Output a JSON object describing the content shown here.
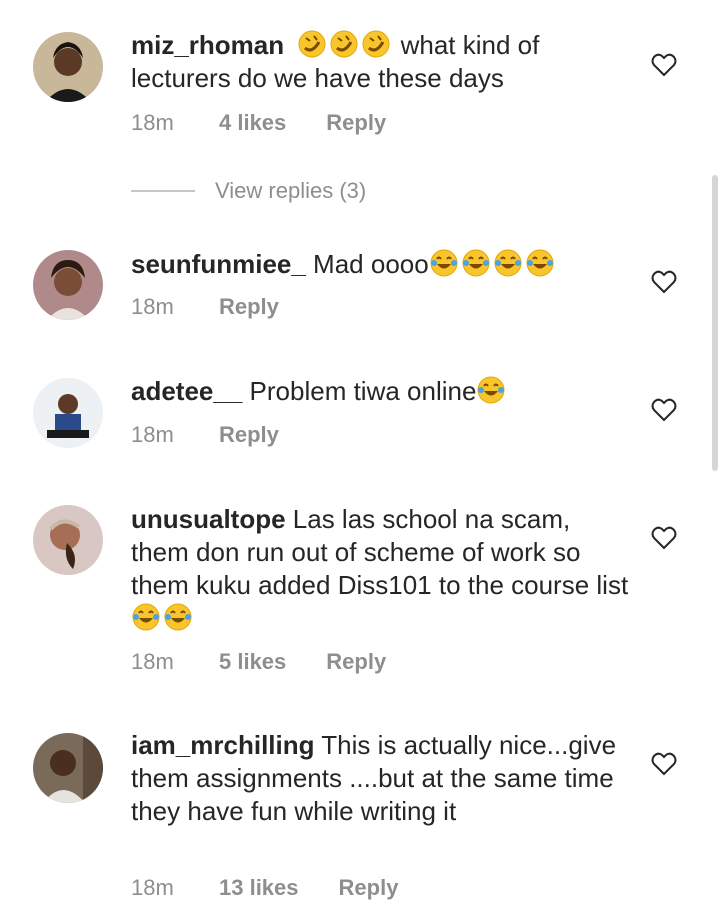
{
  "comments": [
    {
      "username": "miz_rhoman",
      "text": " what kind of lecturers do we have these days",
      "emoji_before": [
        "rofl-emoji",
        "rofl-emoji",
        "rofl-emoji"
      ],
      "time": "18m",
      "likes": "4 likes",
      "reply": "Reply",
      "view_replies": "View replies (3)"
    },
    {
      "username": "seunfunmiee_",
      "text": " Mad oooo",
      "emoji_after": [
        "tears-of-joy-emoji",
        "tears-of-joy-emoji",
        "tears-of-joy-emoji",
        "tears-of-joy-emoji"
      ],
      "time": "18m",
      "reply": "Reply"
    },
    {
      "username": "adetee__",
      "text": " Problem tiwa online",
      "emoji_after": [
        "tears-of-joy-emoji"
      ],
      "time": "18m",
      "reply": "Reply"
    },
    {
      "username": "unusualtope",
      "text": " Las las school na scam, them don run out of scheme of work so them kuku added Diss101 to the course list",
      "emoji_after": [
        "tears-of-joy-emoji",
        "tears-of-joy-emoji"
      ],
      "time": "18m",
      "likes": "5 likes",
      "reply": "Reply"
    },
    {
      "username": "iam_mrchilling",
      "text": " This is actually nice...give them assignments ....but at the same time they have fun while writing it",
      "time": "18m",
      "likes": "13 likes",
      "reply": "Reply"
    }
  ],
  "colors": {
    "text": "#262626",
    "muted": "#8e8e8e",
    "emoji_yellow": "#f9c52c"
  }
}
